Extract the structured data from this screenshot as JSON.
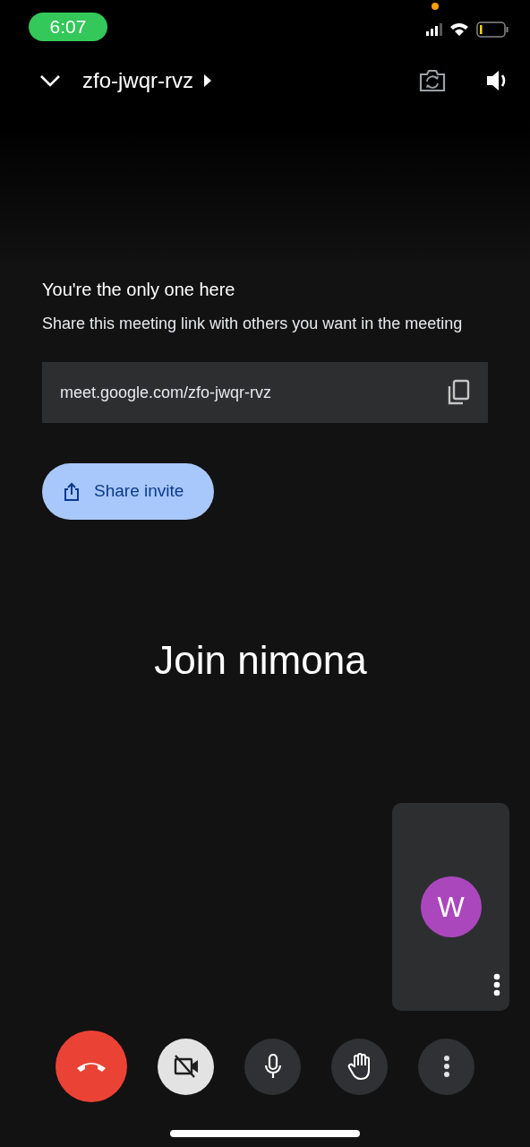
{
  "status_bar": {
    "time": "6:07"
  },
  "header": {
    "meeting_code": "zfo-jwqr-rvz"
  },
  "info": {
    "title": "You're the only one here",
    "message": "Share this meeting link with others you want in the meeting",
    "link": "meet.google.com/zfo-jwqr-rvz",
    "share_button": "Share invite"
  },
  "join_title": "Join nimona",
  "self_view": {
    "initial": "W",
    "color": "#ab47bc"
  },
  "controls": [
    {
      "kind": "end-call"
    },
    {
      "kind": "camera",
      "on": false
    },
    {
      "kind": "mic",
      "on": true
    },
    {
      "kind": "hand"
    },
    {
      "kind": "more"
    }
  ]
}
